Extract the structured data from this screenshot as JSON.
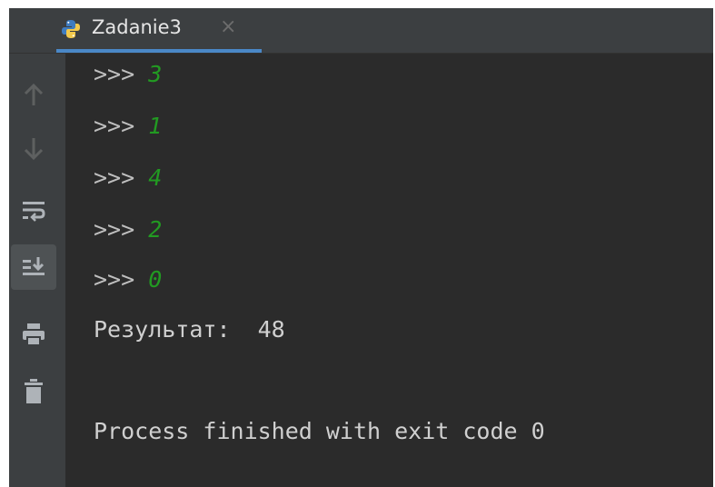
{
  "tab": {
    "title": "Zadanie3",
    "close_glyph": "×",
    "icon": "python-icon"
  },
  "gutter": {
    "icons": [
      "up-arrow-icon",
      "down-arrow-icon",
      "soft-wrap-icon",
      "scroll-to-end-icon",
      "print-icon",
      "trash-icon"
    ],
    "active": "scroll-to-end-icon"
  },
  "console": {
    "prompt": ">>>",
    "inputs": [
      "3",
      "1",
      "4",
      "2",
      "0"
    ],
    "result_label": "Результат:",
    "result_value": "48",
    "exit_message": "Process finished with exit code 0"
  },
  "colors": {
    "background": "#2b2b2b",
    "input_text": "#229a22",
    "tab_underline": "#4a88c7"
  }
}
